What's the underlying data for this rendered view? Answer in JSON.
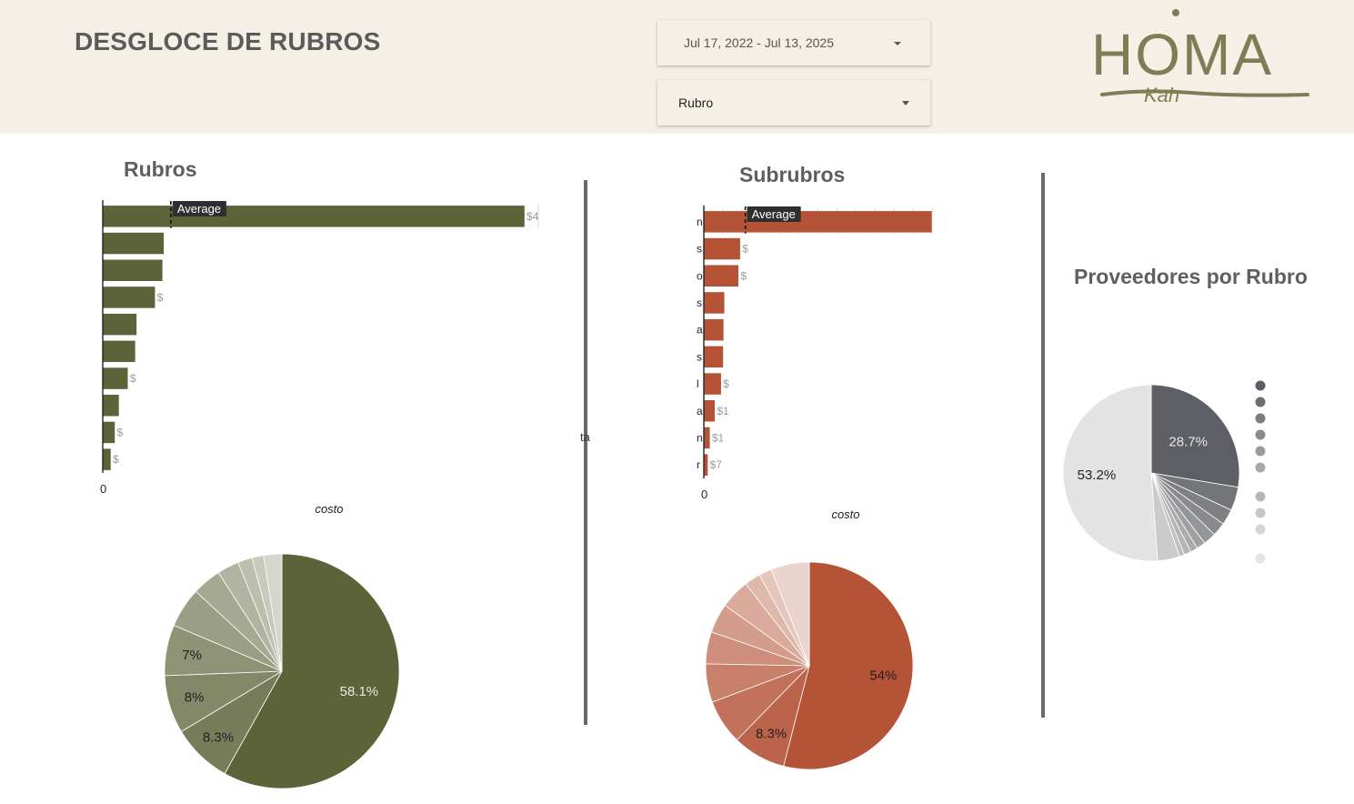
{
  "header": {
    "title": "DESGLOCE DE RUBROS",
    "date_range": "Jul 17, 2022 - Jul 13, 2025",
    "filter_label": "Rubro"
  },
  "logo": {
    "text": "HOMA",
    "subtext": "Kah"
  },
  "colors": {
    "rubros": "#5c6339",
    "subrubros": "#b55337",
    "proveedores": "#5e5f64",
    "header_bg": "#f4f0e6"
  },
  "stray_text": "ta",
  "chart_data": [
    {
      "id": "rubros-bar",
      "type": "bar",
      "orientation": "horizontal",
      "title": "Rubros",
      "xlabel": "costo",
      "x_tick_zero": "0",
      "average_label": "Average",
      "average_value": 1,
      "values": [
        6.2,
        0.9,
        0.88,
        0.77,
        0.5,
        0.48,
        0.37,
        0.24,
        0.18,
        0.12
      ],
      "value_labels": [
        "$4",
        "",
        "",
        "$",
        "",
        "",
        "$",
        "",
        "$",
        "$"
      ],
      "xlim": [
        0,
        6.4
      ]
    },
    {
      "id": "rubros-pie",
      "type": "pie",
      "slices": [
        {
          "value": 58.1,
          "label": "58.1%"
        },
        {
          "value": 8.3,
          "label": "8.3%"
        },
        {
          "value": 8,
          "label": "8%"
        },
        {
          "value": 7,
          "label": "7%"
        },
        {
          "value": 5.5,
          "label": ""
        },
        {
          "value": 4,
          "label": ""
        },
        {
          "value": 3,
          "label": ""
        },
        {
          "value": 2,
          "label": ""
        },
        {
          "value": 1.6,
          "label": ""
        },
        {
          "value": 2.5,
          "label": ""
        }
      ]
    },
    {
      "id": "subrubros-bar",
      "type": "bar",
      "orientation": "horizontal",
      "title": "Subrubros",
      "xlabel": "costo",
      "x_tick_zero": "0",
      "average_label": "Average",
      "average_value": 1,
      "category_fragments": [
        "n",
        "s",
        "o",
        "s",
        "a",
        "s",
        "l",
        "a",
        "n",
        "r"
      ],
      "values": [
        5.5,
        0.88,
        0.84,
        0.5,
        0.48,
        0.47,
        0.42,
        0.27,
        0.15,
        0.1
      ],
      "value_labels": [
        "",
        "$",
        "$",
        "",
        "",
        "",
        "$",
        "$1",
        "$1",
        "$7"
      ],
      "xlim": [
        0,
        5.5
      ]
    },
    {
      "id": "subrubros-pie",
      "type": "pie",
      "slices": [
        {
          "value": 54,
          "label": "54%"
        },
        {
          "value": 8.3,
          "label": "8.3%"
        },
        {
          "value": 7,
          "label": ""
        },
        {
          "value": 6,
          "label": ""
        },
        {
          "value": 5,
          "label": ""
        },
        {
          "value": 4.6,
          "label": ""
        },
        {
          "value": 4.6,
          "label": ""
        },
        {
          "value": 2.5,
          "label": ""
        },
        {
          "value": 2,
          "label": ""
        },
        {
          "value": 6,
          "label": ""
        }
      ]
    },
    {
      "id": "proveedores-pie",
      "type": "pie",
      "title": "Proveedores por Rubro",
      "legend_position": "right",
      "slices": [
        {
          "value": 28.7,
          "label": "28.7%"
        },
        {
          "value": 4.5,
          "label": ""
        },
        {
          "value": 3,
          "label": ""
        },
        {
          "value": 2.6,
          "label": ""
        },
        {
          "value": 2.4,
          "label": ""
        },
        {
          "value": 1.7,
          "label": ""
        },
        {
          "value": 1.4,
          "label": ""
        },
        {
          "value": 1.3,
          "label": ""
        },
        {
          "value": 1,
          "label": ""
        },
        {
          "value": 4.2,
          "label": ""
        },
        {
          "value": 53.2,
          "label": "53.2%"
        }
      ]
    }
  ]
}
